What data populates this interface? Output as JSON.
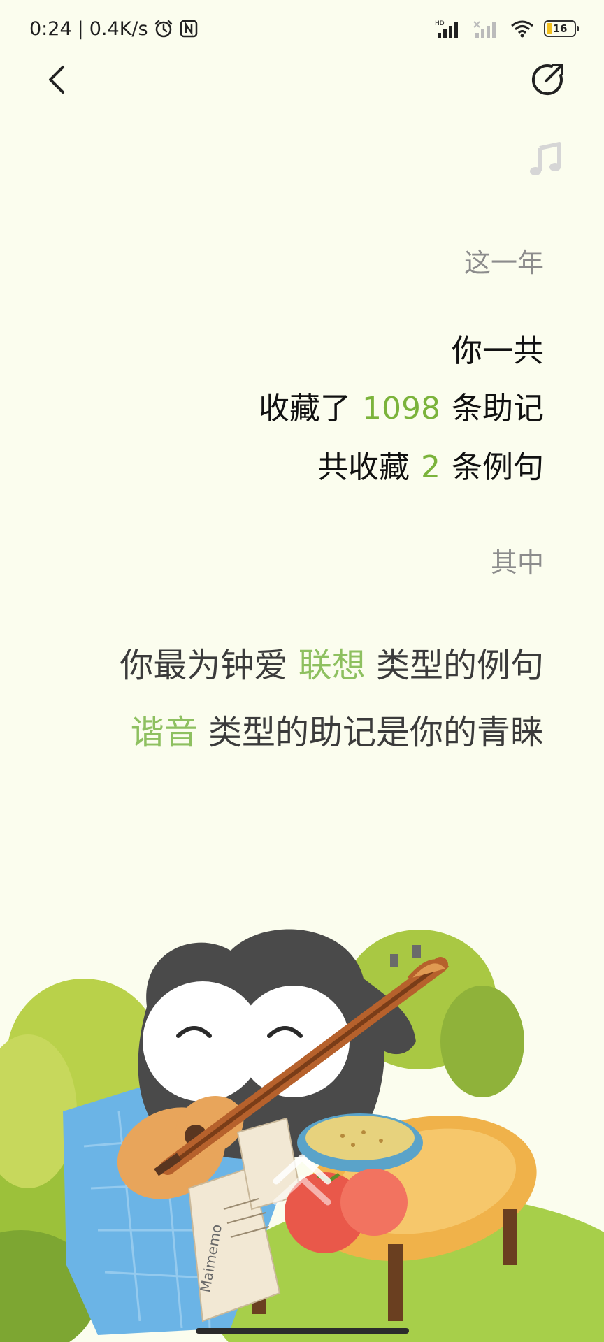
{
  "status_bar": {
    "time": "0:24",
    "speed": "0.4K/s",
    "network_tag": "HD",
    "battery_level": "16"
  },
  "summary": {
    "year_label": "这一年",
    "line1": "你一共",
    "line2_pre": "收藏了",
    "line2_num": "1098",
    "line2_post": "条助记",
    "line3_pre": "共收藏",
    "line3_num": "2",
    "line3_post": "条例句"
  },
  "detail": {
    "among_label": "其中",
    "fav_pre": "你最为钟爱",
    "fav_type": "联想",
    "fav_post": "类型的例句",
    "mnemo_type": "谐音",
    "mnemo_post": "类型的助记是你的青睐"
  },
  "illustration": {
    "paper_text": "Maimemo"
  },
  "colors": {
    "background": "#fbfdee",
    "accent_green": "#7bb33b",
    "soft_green": "#8ec060"
  },
  "icons": [
    "back-arrow-icon",
    "share-icon",
    "music-note-icon",
    "alarm-icon",
    "nfc-icon",
    "signal-icon",
    "wifi-icon",
    "battery-icon"
  ]
}
